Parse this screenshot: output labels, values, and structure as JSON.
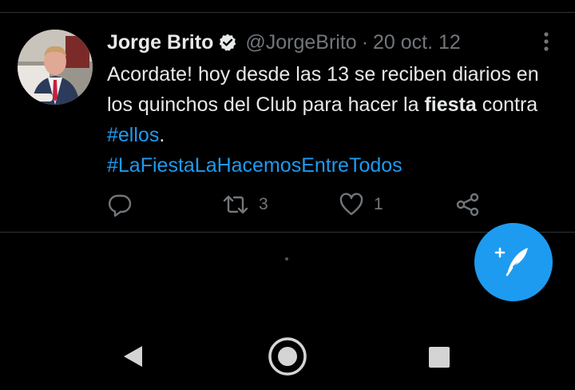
{
  "tweet": {
    "author_name": "Jorge Brito",
    "handle": "@JorgeBrito",
    "separator": "·",
    "date": "20 oct. 12",
    "text": {
      "part1": "Acordate! hoy desde las 13 se reciben diarios en los quinchos del Club para hacer la ",
      "bold": "fiesta",
      "part2": " contra ",
      "hashtag1": "#ellos",
      "part3": ".",
      "hashtag2": "#LaFiestaLaHacemosEntreTodos"
    },
    "actions": {
      "reply_count": "",
      "retweet_count": "3",
      "like_count": "1"
    }
  },
  "icons": {
    "verified": "verified-badge-icon",
    "more": "more-vertical-icon",
    "reply": "reply-icon",
    "retweet": "retweet-icon",
    "like": "heart-icon",
    "share": "share-icon",
    "compose": "compose-tweet-icon",
    "back": "back-triangle-icon",
    "home": "home-circle-icon",
    "recents": "recents-square-icon"
  },
  "colors": {
    "background": "#000000",
    "text": "#e7e9ea",
    "muted": "#71767b",
    "accent": "#1d9bf0",
    "divider": "#2f3336"
  }
}
